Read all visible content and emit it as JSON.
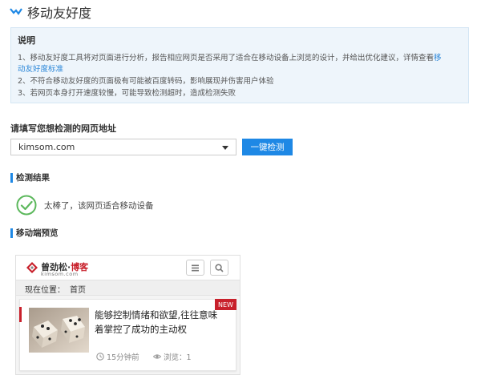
{
  "header": {
    "title": "移动友好度"
  },
  "notice": {
    "title": "说明",
    "line1_text": "1、移动友好度工具将对页面进行分析，报告相应网页是否采用了适合在移动设备上浏览的设计，并给出优化建议，详情查看",
    "line1_link_a": "移",
    "line1_link_b": "动友好度标准",
    "line2": "2、不符合移动友好度的页面极有可能被百度转码，影响展现并伤害用户体验",
    "line3": "3、若网页本身打开速度较慢，可能导致检测超时，造成检测失败"
  },
  "form": {
    "url_label": "请填写您想检测的网页地址",
    "url_value": "kimsom.com",
    "check_button": "一键检测"
  },
  "result": {
    "section_title": "检测结果",
    "message": "太棒了，该网页适合移动设备"
  },
  "preview": {
    "section_title": "移动端预览",
    "brand": "曾劲松",
    "brand_sep": "·",
    "brand_blog": "博客",
    "domain": "kimsom.com",
    "location_label": "现在位置：",
    "location_value": "首页",
    "card": {
      "title": "能够控制情绪和欲望,往往意味着掌控了成功的主动权",
      "badge": "NEW",
      "time": "15分钟前",
      "views": "浏览：1"
    }
  },
  "colors": {
    "accent": "#1e88e5",
    "brand_red": "#c8202b",
    "success": "#5cb85c",
    "notice_bg": "#eef5fb"
  }
}
